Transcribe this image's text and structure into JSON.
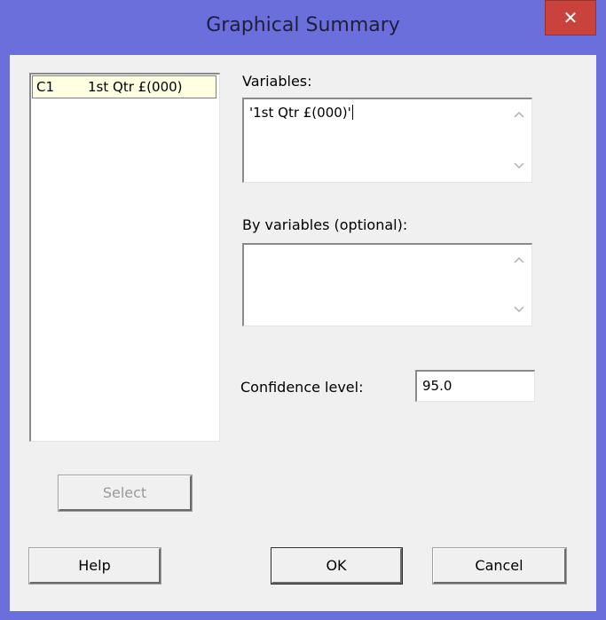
{
  "window": {
    "title": "Graphical Summary",
    "close_glyph": "✕"
  },
  "columns_list": {
    "items": [
      {
        "id": "C1",
        "name": "1st Qtr £(000)"
      }
    ]
  },
  "variables": {
    "label": "Variables:",
    "value": "'1st Qtr £(000)'"
  },
  "by_variables": {
    "label": "By variables (optional):",
    "value": ""
  },
  "confidence": {
    "label": "Confidence level:",
    "value": "95.0"
  },
  "buttons": {
    "select": "Select",
    "help": "Help",
    "ok": "OK",
    "cancel": "Cancel"
  },
  "colors": {
    "title_bar": "#6b6fdc",
    "close_button": "#c9423b",
    "dialog_bg": "#f0f0f0",
    "list_selection_bg": "#ffffe1"
  }
}
